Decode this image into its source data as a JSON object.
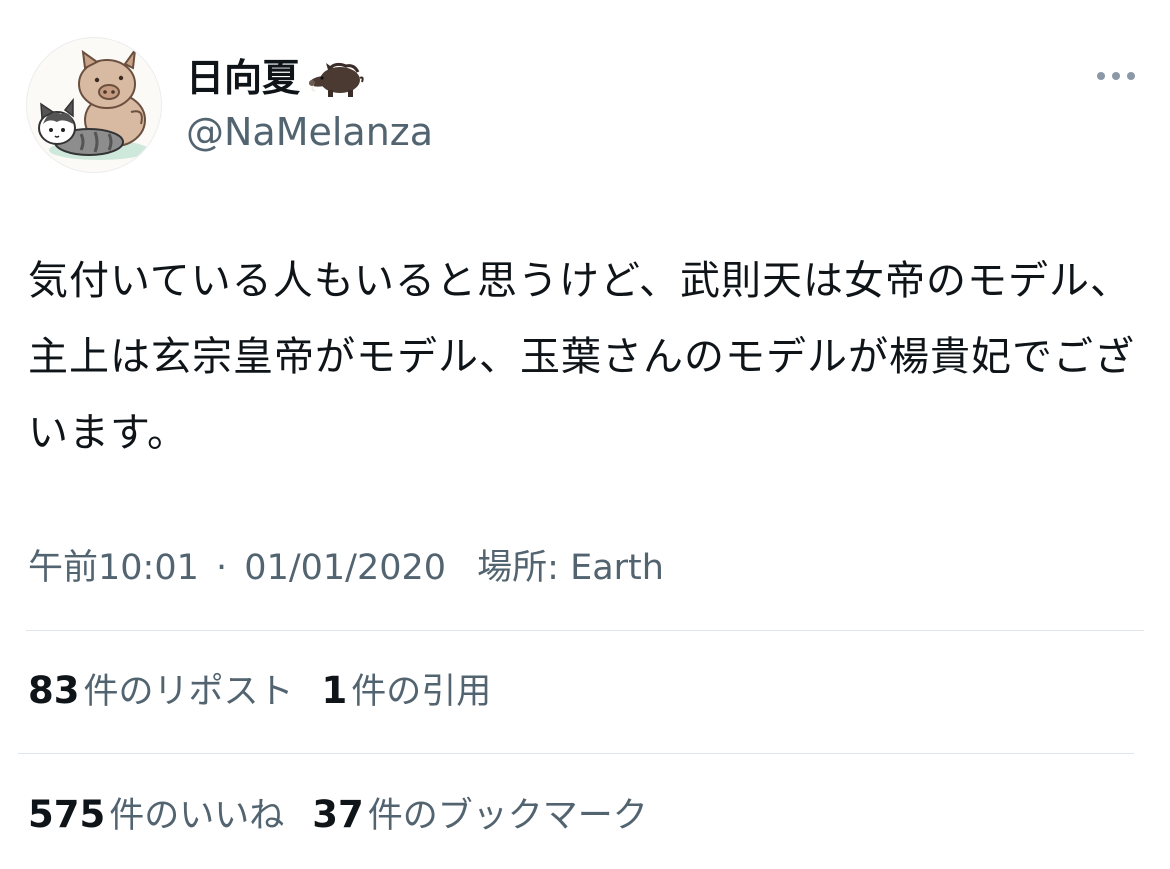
{
  "author": {
    "display_name": "日向夏",
    "name_emoji": "boar-icon",
    "handle": "@NaMelanza",
    "avatar": "avatar-illustration-pig-and-cat"
  },
  "tweet": {
    "text": "気付いている人もいると思うけど、武則天は女帝のモデル、主上は玄宗皇帝がモデル、玉葉さんのモデルが楊貴妃でございます。",
    "time": "午前10:01",
    "separator": "·",
    "date": "01/01/2020",
    "location_label": "場所:",
    "location": "Earth"
  },
  "stats": {
    "reposts": {
      "count": "83",
      "label": "件のリポスト"
    },
    "quotes": {
      "count": "1",
      "label": "件の引用"
    },
    "likes": {
      "count": "575",
      "label": "件のいいね"
    },
    "bookmarks": {
      "count": "37",
      "label": "件のブックマーク"
    }
  },
  "colors": {
    "text": "#0f1419",
    "secondary": "#536471",
    "divider": "#e1e6ea"
  }
}
